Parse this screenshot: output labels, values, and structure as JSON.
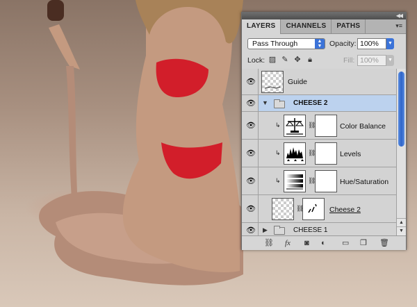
{
  "panel": {
    "tabs": [
      {
        "label": "LAYERS",
        "active": true
      },
      {
        "label": "CHANNELS",
        "active": false
      },
      {
        "label": "PATHS",
        "active": false
      }
    ],
    "blend_mode": "Pass Through",
    "opacity_label": "Opacity:",
    "opacity_value": "100%",
    "lock_label": "Lock:",
    "fill_label": "Fill:",
    "fill_value": "100%"
  },
  "layers": [
    {
      "name": "Guide",
      "type": "pixel",
      "visible": true
    },
    {
      "name": "CHEESE 2",
      "type": "group",
      "expanded": true,
      "selected": true,
      "visible": true
    },
    {
      "name": "Color Balance",
      "type": "adjustment",
      "icon": "color-balance-icon",
      "clipped": true,
      "visible": true
    },
    {
      "name": "Levels",
      "type": "adjustment",
      "icon": "levels-icon",
      "clipped": true,
      "visible": true
    },
    {
      "name": "Hue/Saturation",
      "type": "adjustment",
      "icon": "hue-saturation-icon",
      "clipped": true,
      "visible": true
    },
    {
      "name": "Cheese 2",
      "type": "pixel-with-mask",
      "visible": true
    },
    {
      "name": "CHEESE 1",
      "type": "group",
      "expanded": false,
      "visible": true
    }
  ],
  "colors": {
    "selected_row": "#bcd2ee",
    "accent": "#3b73d8"
  }
}
